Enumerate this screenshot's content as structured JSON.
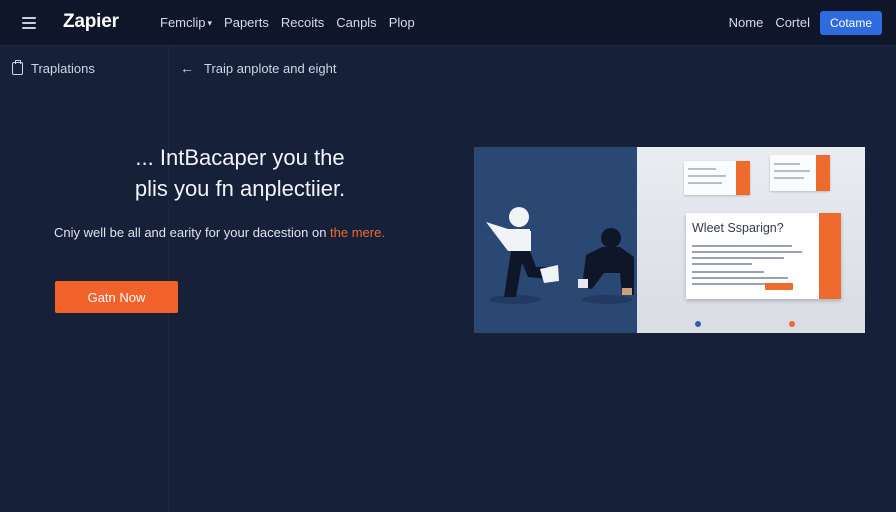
{
  "header": {
    "logo": "Zapier",
    "nav": [
      {
        "label": "Femclip",
        "has_caret": true
      },
      {
        "label": "Paperts",
        "has_caret": false
      },
      {
        "label": "Recoits",
        "has_caret": false
      },
      {
        "label": "Canpls",
        "has_caret": false
      },
      {
        "label": "Plop",
        "has_caret": false
      }
    ],
    "right_links": [
      "Nome",
      "Cortel"
    ],
    "cta_label": "Cotame"
  },
  "sidebar": {
    "title": "Traplations"
  },
  "subheader": {
    "back_label": "Traip anplote and eight"
  },
  "hero": {
    "title_line1": "... IntBacaper you the",
    "title_line2": "plis you fn anplectiier.",
    "subtitle": "Cniy well be all and earity for your dacestion on ",
    "subtitle_accent": "the mere.",
    "button_label": "Gatn Now"
  },
  "illustration": {
    "card_title": "Wleet Ssparign?",
    "accent_color": "#ef6a2d"
  },
  "colors": {
    "background": "#172039",
    "nav_background": "#0f1629",
    "cta_blue": "#2e6bdf",
    "primary_orange": "#f2622a"
  }
}
